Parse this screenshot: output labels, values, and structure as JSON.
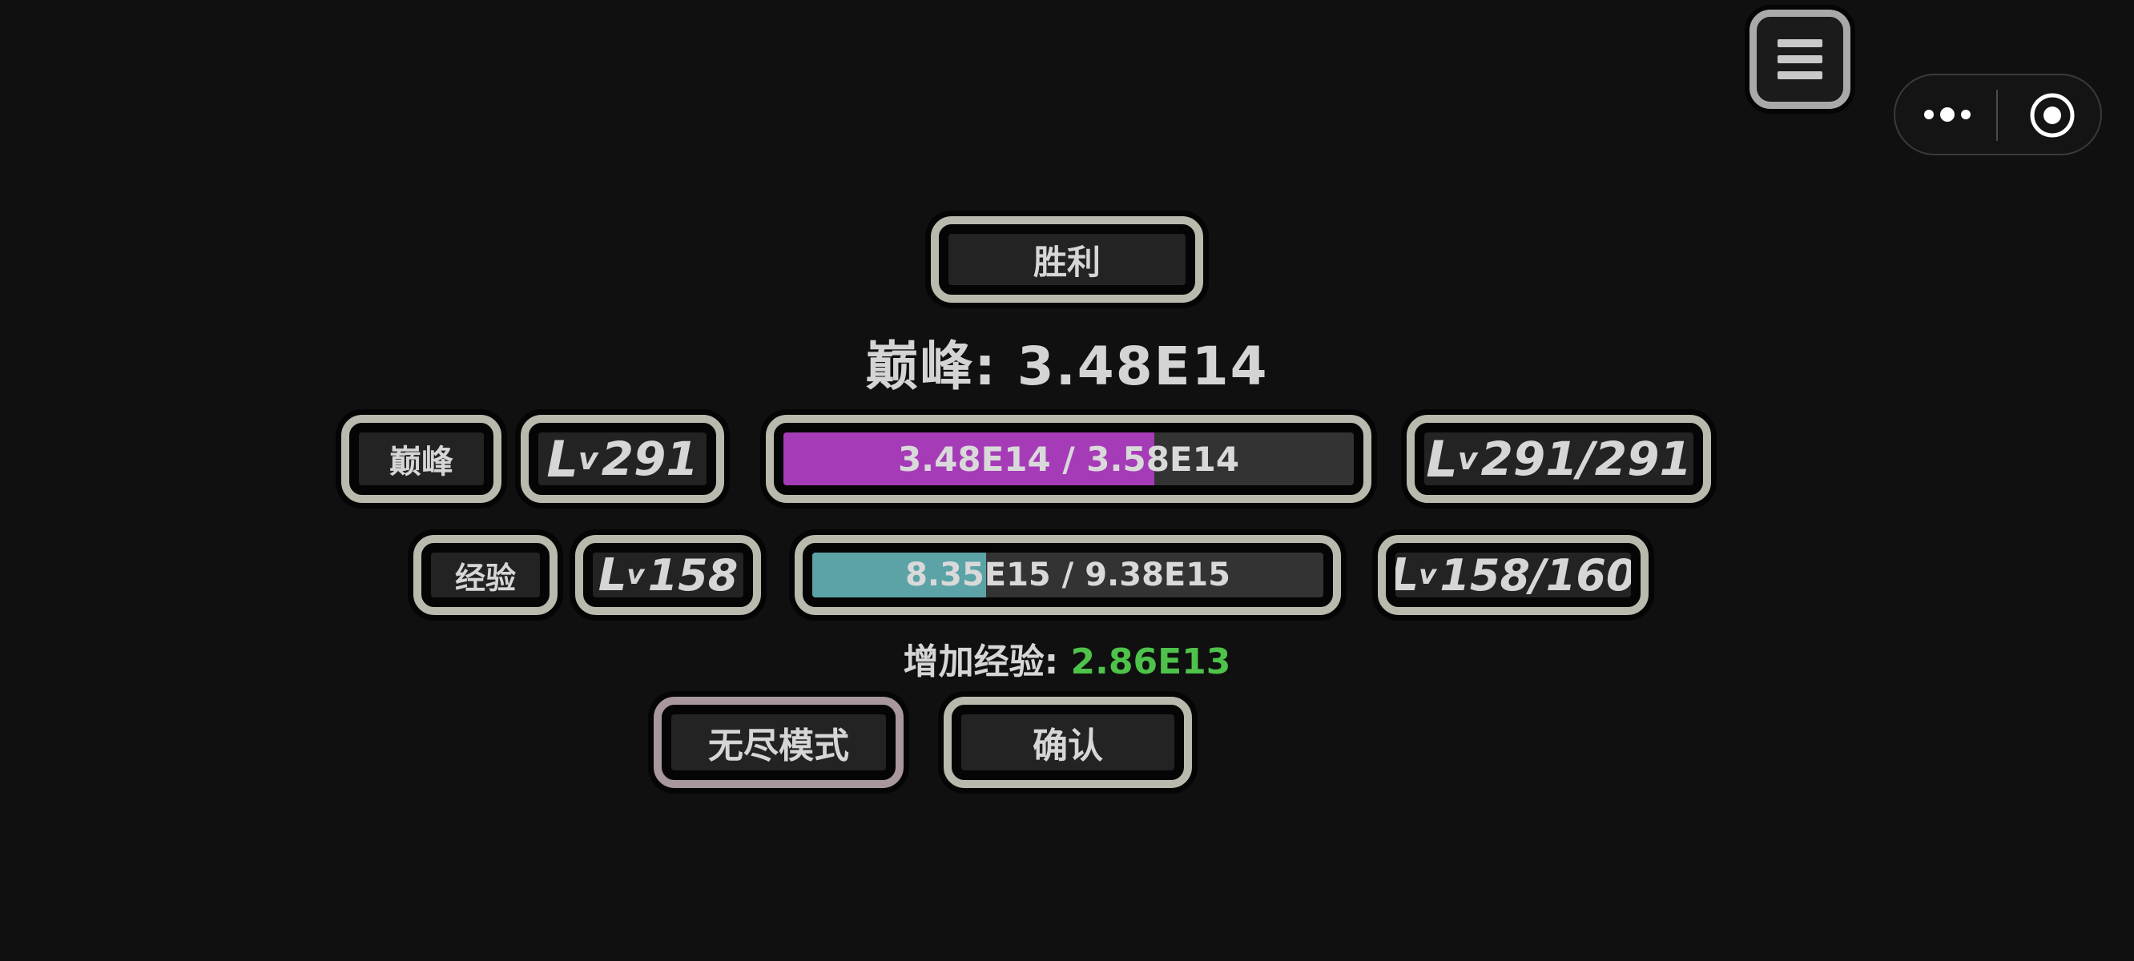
{
  "header": {
    "victory": "胜利",
    "peak_summary": "巅峰: 3.48E14"
  },
  "peak_row": {
    "label": "巅峰",
    "lv_prefix_L": "L",
    "lv_prefix_v": "v",
    "level": "291",
    "bar_text": "3.48E14 / 3.58E14",
    "bar_fraction": 0.65,
    "bar_color": "#a63bb8",
    "max_level": "291/291"
  },
  "exp_row": {
    "label": "经验",
    "lv_prefix_L": "L",
    "lv_prefix_v": "v",
    "level": "158",
    "bar_text": "8.35E15 / 9.38E15",
    "bar_fraction": 0.34,
    "bar_color": "#5ba3a6",
    "max_level": "158/160"
  },
  "gain": {
    "label": "增加经验: ",
    "value": "2.86E13",
    "value_color": "#4ec24a"
  },
  "buttons": {
    "endless": "无尽模式",
    "confirm": "确认"
  },
  "icons": {
    "menu": "hamburger-menu-icon",
    "more": "more-dots-icon",
    "close": "target-circle-icon"
  }
}
